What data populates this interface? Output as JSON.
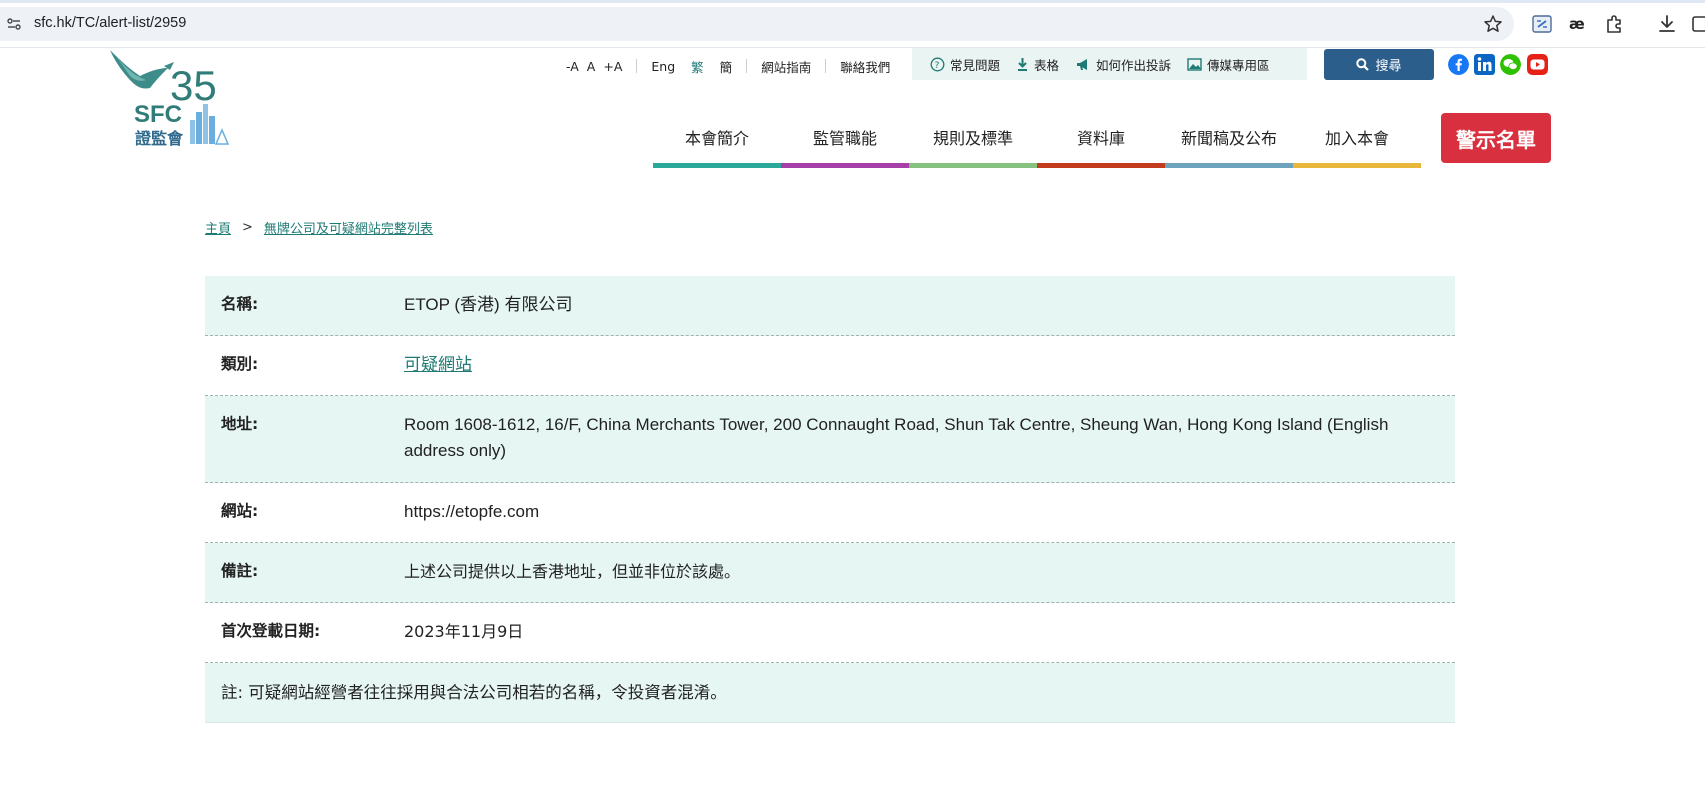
{
  "browser": {
    "url": "sfc.hk/TC/alert-list/2959"
  },
  "logo": {
    "text": "SFC",
    "anniversary": "35",
    "chinese": "證監會"
  },
  "utility": {
    "font_small": "-A",
    "font_normal": "A",
    "font_large": "+A",
    "lang_en": "Eng",
    "lang_tc": "繁",
    "lang_sc": "簡",
    "site_guide": "網站指南",
    "contact_us": "聯絡我們",
    "faq": "常見問題",
    "forms": "表格",
    "complaint": "如何作出投訴",
    "media": "傳媒專用區",
    "search": "搜尋"
  },
  "nav": {
    "items": [
      {
        "label": "本會簡介",
        "color": "#2aa89a"
      },
      {
        "label": "監管職能",
        "color": "#a63fa8"
      },
      {
        "label": "規則及標準",
        "color": "#86c17f"
      },
      {
        "label": "資料庫",
        "color": "#c23b1c"
      },
      {
        "label": "新聞稿及公布",
        "color": "#6ea3be"
      },
      {
        "label": "加入本會",
        "color": "#e8b63a"
      }
    ],
    "alert_list": "警示名單"
  },
  "breadcrumb": {
    "home": "主頁",
    "separator": ">",
    "current": "無牌公司及可疑網站完整列表"
  },
  "details": {
    "name_label": "名稱:",
    "name_value": "ETOP (香港) 有限公司",
    "category_label": "類別:",
    "category_value": "可疑網站",
    "address_label": "地址:",
    "address_value": "Room 1608-1612, 16/F, China Merchants Tower, 200 Connaught Road, Shun Tak Centre, Sheung Wan, Hong Kong Island (English address only)",
    "website_label": "網站:",
    "website_value": "https://etopfe.com",
    "remarks_label": "備註:",
    "remarks_value": "上述公司提供以上香港地址，但並非位於該處。",
    "date_label": "首次登載日期:",
    "date_value": "2023年11月9日",
    "note": "註: 可疑網站經營者往往採用與合法公司相若的名稱，令投資者混淆。"
  },
  "colors": {
    "teal": "#1e7a74",
    "row_alt": "#e6f6f3",
    "alert_red": "#d9303f",
    "search_blue": "#2c5e8c"
  }
}
